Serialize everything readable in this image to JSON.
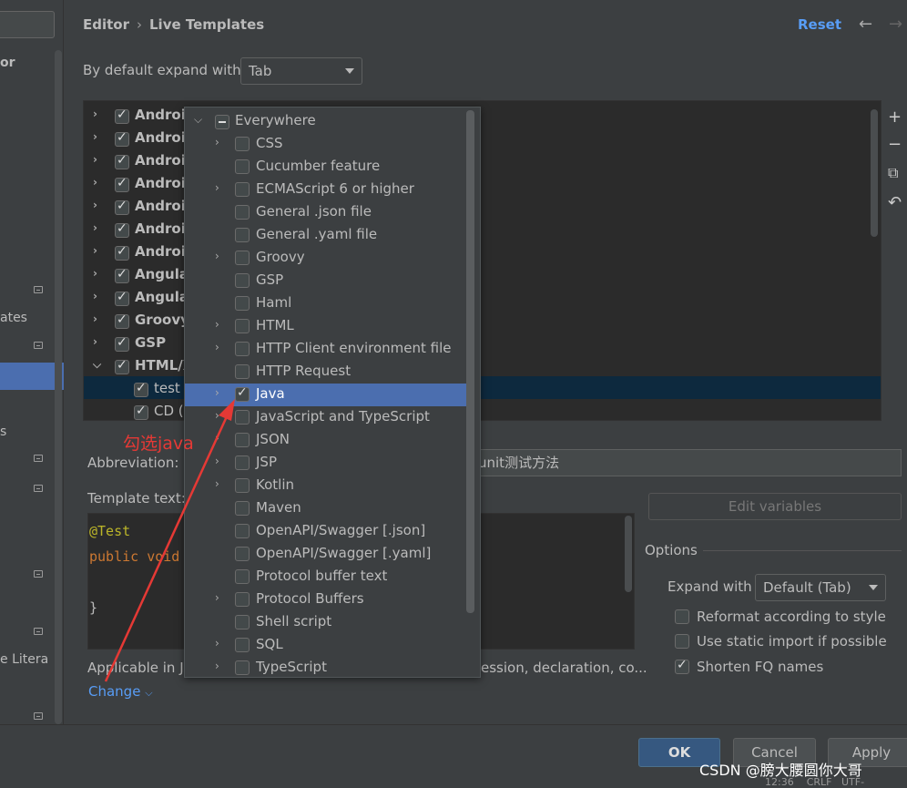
{
  "header": {
    "crumb1": "Editor",
    "crumb2": "Live Templates",
    "separator": "›",
    "reset": "Reset",
    "back": "←",
    "forward": "→"
  },
  "sidebar": {
    "fragments": [
      "or",
      "ates",
      "s",
      "e Litera"
    ]
  },
  "expand": {
    "label": "By default expand with",
    "value": "Tab"
  },
  "tree": {
    "rows": [
      {
        "label": "Android",
        "checked": true,
        "expandable": true
      },
      {
        "label": "Android",
        "checked": true,
        "expandable": true
      },
      {
        "label": "Android",
        "checked": true,
        "expandable": true
      },
      {
        "label": "Android",
        "checked": true,
        "expandable": true
      },
      {
        "label": "Android",
        "checked": true,
        "expandable": true
      },
      {
        "label": "Android",
        "checked": true,
        "expandable": true
      },
      {
        "label": "Android",
        "checked": true,
        "expandable": true
      },
      {
        "label": "Angula",
        "checked": true,
        "expandable": true
      },
      {
        "label": "Angula",
        "checked": true,
        "expandable": true
      },
      {
        "label": "Groovy",
        "checked": true,
        "expandable": true
      },
      {
        "label": "GSP",
        "checked": true,
        "expandable": true
      },
      {
        "label": "HTML/X",
        "checked": true,
        "expandable": true,
        "expanded": true
      },
      {
        "label": "test",
        "checked": true,
        "child": true,
        "selected": true
      },
      {
        "label": "CD (S",
        "checked": true,
        "child": true
      }
    ]
  },
  "side_tools": {
    "add": "+",
    "remove": "−",
    "copy": "⧉",
    "restore": "↶"
  },
  "form": {
    "abbreviation_label": "Abbreviation:",
    "description_value": "unit测试方法",
    "template_text_label": "Template text:",
    "code_line1": "@Test",
    "code_line2_kw": "public void",
    "code_line3": "}",
    "applicable_label": "Applicable in J",
    "applicable_rest": "ession, declaration, co...",
    "change_link": "Change"
  },
  "options": {
    "edit_variables": "Edit variables",
    "title": "Options",
    "expand_with_label": "Expand with",
    "expand_with_value": "Default (Tab)",
    "reformat": "Reformat according to style",
    "static_import": "Use static import if possible",
    "shorten_fq": "Shorten FQ names",
    "reformat_checked": false,
    "static_import_checked": false,
    "shorten_fq_checked": true
  },
  "popup": {
    "root": "Everywhere",
    "items": [
      {
        "label": "CSS",
        "expandable": true,
        "checked": false
      },
      {
        "label": "Cucumber feature",
        "expandable": false,
        "checked": false
      },
      {
        "label": "ECMAScript 6 or higher",
        "expandable": true,
        "checked": false
      },
      {
        "label": "General .json file",
        "expandable": false,
        "checked": false
      },
      {
        "label": "General .yaml file",
        "expandable": false,
        "checked": false
      },
      {
        "label": "Groovy",
        "expandable": true,
        "checked": false
      },
      {
        "label": "GSP",
        "expandable": false,
        "checked": false
      },
      {
        "label": "Haml",
        "expandable": false,
        "checked": false
      },
      {
        "label": "HTML",
        "expandable": true,
        "checked": false
      },
      {
        "label": "HTTP Client environment file",
        "expandable": true,
        "checked": false
      },
      {
        "label": "HTTP Request",
        "expandable": false,
        "checked": false
      },
      {
        "label": "Java",
        "expandable": true,
        "checked": true,
        "selected": true
      },
      {
        "label": "JavaScript and TypeScript",
        "expandable": true,
        "checked": false
      },
      {
        "label": "JSON",
        "expandable": true,
        "checked": false
      },
      {
        "label": "JSP",
        "expandable": true,
        "checked": false
      },
      {
        "label": "Kotlin",
        "expandable": true,
        "checked": false
      },
      {
        "label": "Maven",
        "expandable": false,
        "checked": false
      },
      {
        "label": "OpenAPI/Swagger [.json]",
        "expandable": false,
        "checked": false
      },
      {
        "label": "OpenAPI/Swagger [.yaml]",
        "expandable": false,
        "checked": false
      },
      {
        "label": "Protocol buffer text",
        "expandable": false,
        "checked": false
      },
      {
        "label": "Protocol Buffers",
        "expandable": true,
        "checked": false
      },
      {
        "label": "Shell script",
        "expandable": false,
        "checked": false
      },
      {
        "label": "SQL",
        "expandable": true,
        "checked": false
      },
      {
        "label": "TypeScript",
        "expandable": true,
        "checked": false
      }
    ]
  },
  "annotation": {
    "text": "勾选java",
    "color": "#e53935"
  },
  "buttons": {
    "ok": "OK",
    "cancel": "Cancel",
    "apply": "Apply"
  },
  "watermark": "CSDN @膀大腰圆你大哥",
  "status": {
    "time": "12:36",
    "line_sep": "CRLF",
    "encoding": "UTF-"
  },
  "colors": {
    "accent": "#589df6",
    "selection": "#4b6eaf",
    "annotation": "#e53935"
  }
}
